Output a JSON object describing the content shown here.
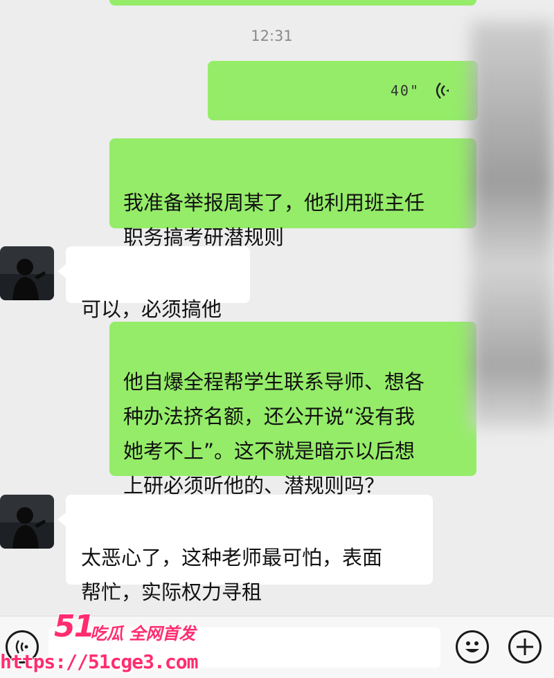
{
  "timestamp": "12:31",
  "voice_message": {
    "duration": "40\""
  },
  "messages": [
    {
      "side": "out",
      "text": "我准备举报周某了，他利用班主任\n职务搞考研潜规则"
    },
    {
      "side": "in",
      "text": "可以，必须搞他"
    },
    {
      "side": "out",
      "text": "他自爆全程帮学生联系导师、想各\n种办法挤名额，还公开说“没有我\n她考不上”。这不就是暗示以后想\n上研必须听他的、潜规则吗？"
    },
    {
      "side": "in",
      "text": "太恶心了，这种老师最可怕，表面\n帮忙，实际权力寻租"
    }
  ],
  "watermark": {
    "logo": "51",
    "slogan": "吃瓜 全网首发",
    "url": "https://51cge3.com"
  },
  "colors": {
    "outgoing_bubble": "#95ec69",
    "incoming_bubble": "#ffffff",
    "background": "#ededed",
    "watermark": "#ff2d6f"
  },
  "icons": {
    "voice": "voice-wave-icon",
    "emoji": "emoji-icon",
    "add": "plus-icon",
    "voice_input": "voice-input-icon"
  }
}
